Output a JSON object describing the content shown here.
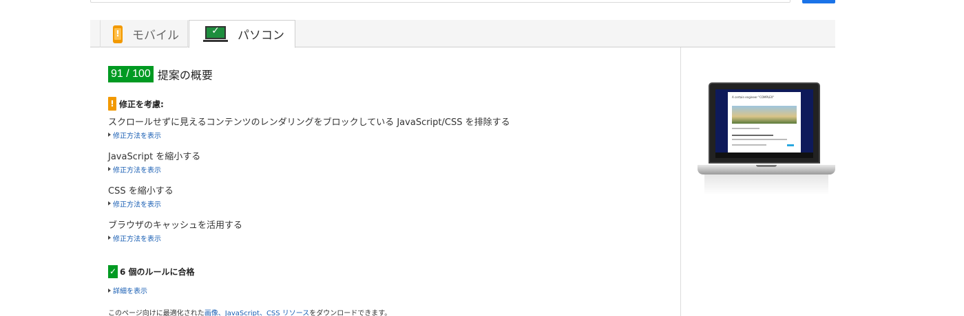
{
  "tabs": {
    "mobile_label": "モバイル",
    "desktop_label": "パソコン"
  },
  "score": {
    "value": "91 / 100",
    "title": "提案の概要"
  },
  "warning_section": {
    "heading": "修正を考慮:",
    "items": [
      {
        "title": "スクロールせずに見えるコンテンツのレンダリングをブロックしている JavaScript/CSS を排除する",
        "link": "修正方法を表示"
      },
      {
        "title": "JavaScript を縮小する",
        "link": "修正方法を表示"
      },
      {
        "title": "CSS を縮小する",
        "link": "修正方法を表示"
      },
      {
        "title": "ブラウザのキャッシュを活用する",
        "link": "修正方法を表示"
      }
    ]
  },
  "pass_section": {
    "heading": "6 個のルールに合格",
    "link": "詳細を表示"
  },
  "bottom_note": {
    "prefix": "このページ向けに最適化された",
    "link": "画像、JavaScript、CSS リソース",
    "suffix": "をダウンロードできます。"
  },
  "preview": {
    "site_title": "A certain engineer \"COMPLEX\""
  },
  "colors": {
    "score_green": "#009a22",
    "warning_orange": "#f29900",
    "link_blue": "#1a5fb4"
  }
}
